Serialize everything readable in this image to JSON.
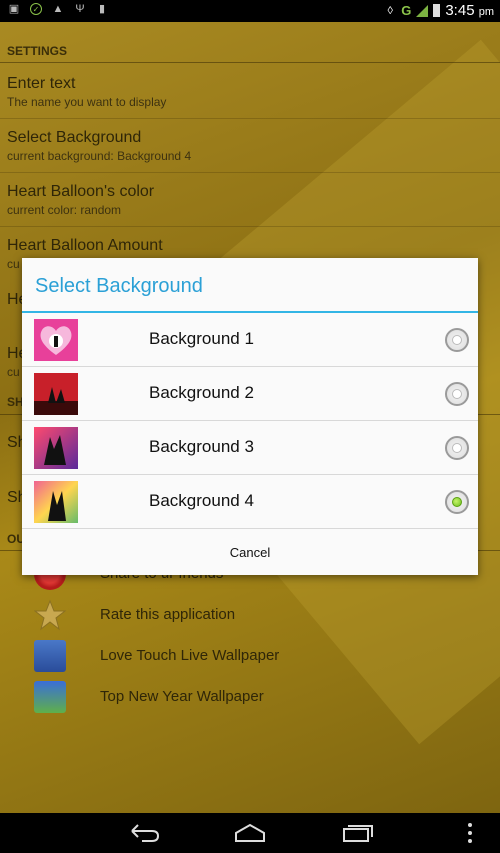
{
  "status_bar": {
    "network": "G",
    "time": "3:45",
    "ampm": "pm",
    "icons": [
      "screenshot-icon",
      "battery-saver-icon",
      "warning-icon",
      "usb-icon",
      "sd-card-icon"
    ]
  },
  "settings": {
    "section_settings": "SETTINGS",
    "prefs": [
      {
        "title": "Enter text",
        "summary": "The name you want to display"
      },
      {
        "title": "Select Background",
        "summary": "current background: Background 4"
      },
      {
        "title": "Heart Balloon's color",
        "summary": "current color: random"
      },
      {
        "title": "Heart Balloon Amount",
        "summary": "cu"
      },
      {
        "title": "He",
        "summary": ""
      },
      {
        "title": "He",
        "summary": "cu"
      }
    ],
    "section_2": "SH",
    "share_items": [
      "Sh",
      "Sh"
    ],
    "section_3": "OU",
    "apps": [
      {
        "label": "Share to ur friends",
        "icon": "share-icon"
      },
      {
        "label": "Rate this application",
        "icon": "star-icon"
      },
      {
        "label": "Love Touch Live Wallpaper",
        "icon": "love-touch-icon"
      },
      {
        "label": "Top New Year Wallpaper",
        "icon": "new-year-icon"
      }
    ]
  },
  "dialog": {
    "title": "Select Background",
    "options": [
      {
        "label": "Background 1",
        "checked": false
      },
      {
        "label": "Background 2",
        "checked": false
      },
      {
        "label": "Background 3",
        "checked": false
      },
      {
        "label": "Background 4",
        "checked": true
      }
    ],
    "selected_index": 3,
    "cancel_label": "Cancel"
  },
  "colors": {
    "accent": "#33b5e5",
    "radio_checked": "#6cc11d",
    "background_gold": "#9c7e1a"
  },
  "navbar": {
    "buttons": [
      "back-icon",
      "home-icon",
      "recent-apps-icon",
      "menu-icon"
    ]
  }
}
